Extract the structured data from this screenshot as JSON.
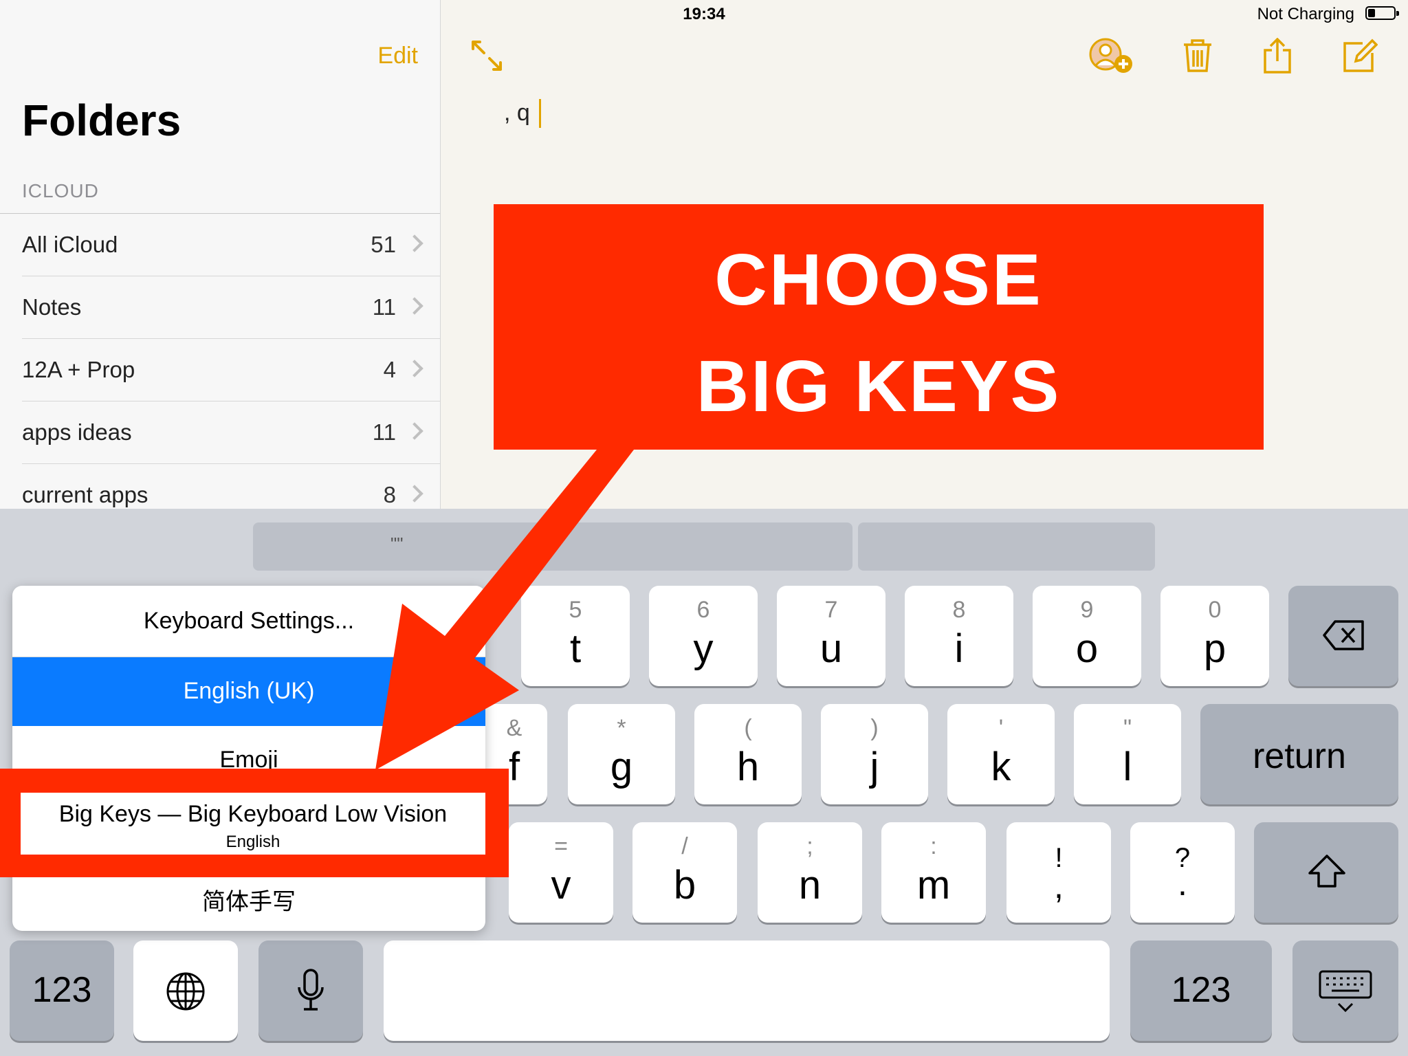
{
  "status_bar": {
    "device": "iPad",
    "time": "19:34",
    "battery_text": "Not Charging"
  },
  "sidebar": {
    "edit_label": "Edit",
    "title": "Folders",
    "section": "ICLOUD",
    "folders": [
      {
        "label": "All iCloud",
        "count": "51"
      },
      {
        "label": "Notes",
        "count": "11"
      },
      {
        "label": "12A + Prop",
        "count": "4"
      },
      {
        "label": "apps ideas",
        "count": "11"
      },
      {
        "label": "current apps",
        "count": "8"
      }
    ]
  },
  "toolbar": {
    "icons": [
      "expand-icon",
      "add-person-icon",
      "trash-icon",
      "share-icon",
      "compose-icon"
    ]
  },
  "note": {
    "text": ", q"
  },
  "callout": {
    "line1": "CHOOSE",
    "line2": "BIG KEYS",
    "color": "#ff2a00"
  },
  "keyboard": {
    "suggestion": "\"\"",
    "row1": [
      {
        "alt": "5",
        "main": "t"
      },
      {
        "alt": "6",
        "main": "y"
      },
      {
        "alt": "7",
        "main": "u"
      },
      {
        "alt": "8",
        "main": "i"
      },
      {
        "alt": "9",
        "main": "o"
      },
      {
        "alt": "0",
        "main": "p"
      }
    ],
    "row2": [
      {
        "alt": "&",
        "main": "f"
      },
      {
        "alt": "*",
        "main": "g"
      },
      {
        "alt": "(",
        "main": "h"
      },
      {
        "alt": ")",
        "main": "j"
      },
      {
        "alt": "'",
        "main": "k"
      },
      {
        "alt": "\"",
        "main": "l"
      }
    ],
    "row3": [
      {
        "alt": "=",
        "main": "v"
      },
      {
        "alt": "/",
        "main": "b"
      },
      {
        "alt": ";",
        "main": "n"
      },
      {
        "alt": ":",
        "main": "m"
      },
      {
        "alt": "!",
        "main": ","
      },
      {
        "alt": "?",
        "main": "."
      }
    ],
    "return_label": "return",
    "numbers_label": "123",
    "numbers_label_right": "123",
    "accent": "#0a7bff"
  },
  "keyboard_menu": {
    "items": [
      "Keyboard Settings...",
      "English (UK)",
      "Emoji"
    ],
    "big_keys_title": "Big Keys — Big Keyboard Low Vision",
    "big_keys_subtitle": "English",
    "last_item": "简体手写"
  }
}
